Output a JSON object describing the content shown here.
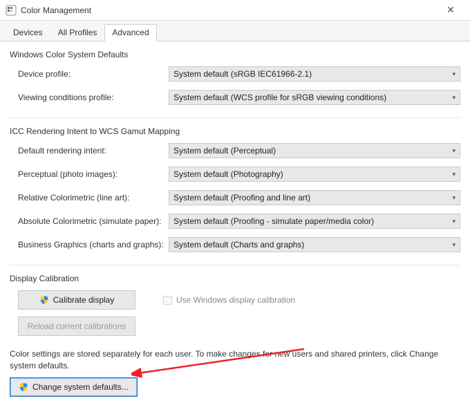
{
  "window": {
    "title": "Color Management"
  },
  "tabs": {
    "devices": "Devices",
    "all_profiles": "All Profiles",
    "advanced": "Advanced"
  },
  "wcsd": {
    "heading": "Windows Color System Defaults",
    "device_profile_label": "Device profile:",
    "device_profile_value": "System default (sRGB IEC61966-2.1)",
    "viewing_label": "Viewing conditions profile:",
    "viewing_value": "System default (WCS profile for sRGB viewing conditions)"
  },
  "icc": {
    "heading": "ICC Rendering Intent to WCS Gamut Mapping",
    "default_label": "Default rendering intent:",
    "default_value": "System default (Perceptual)",
    "perceptual_label": "Perceptual (photo images):",
    "perceptual_value": "System default (Photography)",
    "relcol_label": "Relative Colorimetric (line art):",
    "relcol_value": "System default (Proofing and line art)",
    "abscol_label": "Absolute Colorimetric (simulate paper):",
    "abscol_value": "System default (Proofing - simulate paper/media color)",
    "bizgfx_label": "Business Graphics (charts and graphs):",
    "bizgfx_value": "System default (Charts and graphs)"
  },
  "calib": {
    "heading": "Display Calibration",
    "calibrate_btn": "Calibrate display",
    "use_windows_chk": "Use Windows display calibration",
    "reload_btn": "Reload current calibrations"
  },
  "footer": {
    "note": "Color settings are stored separately for each user. To make changes for new users and shared printers, click Change system defaults.",
    "change_btn": "Change system defaults..."
  }
}
